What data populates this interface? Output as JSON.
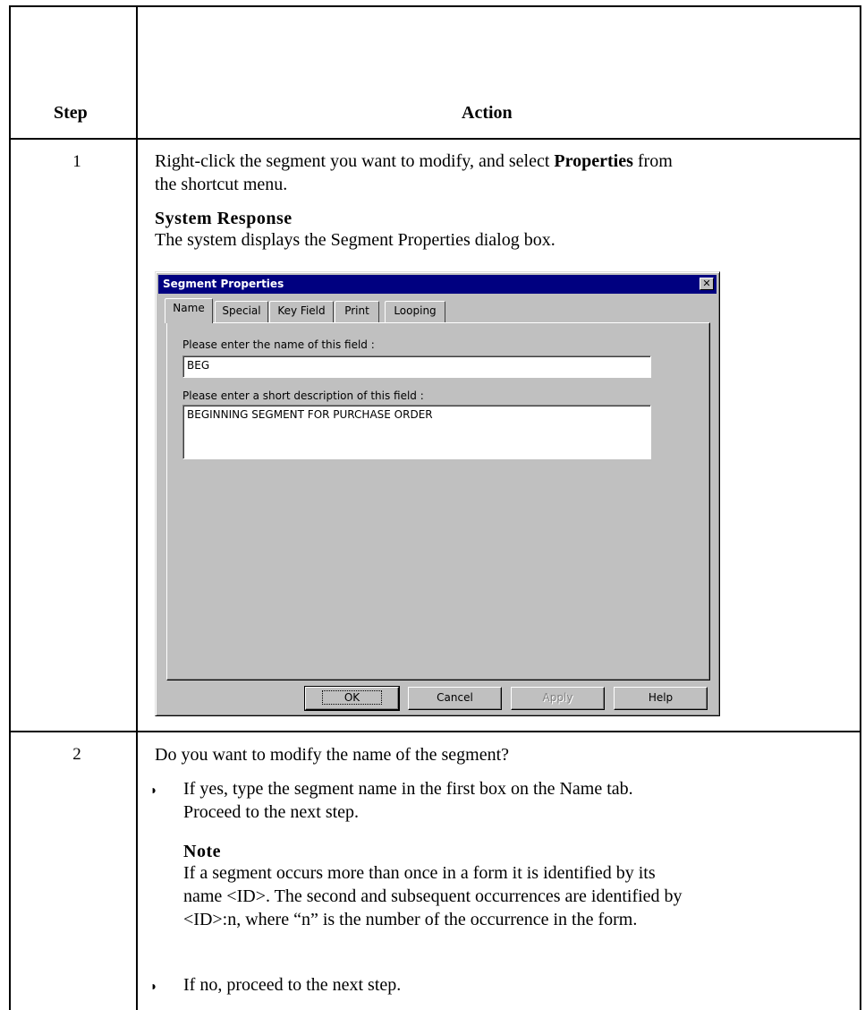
{
  "table": {
    "header_step": "Step",
    "header_action": "Action"
  },
  "step1": {
    "number": "1",
    "line1_pre": "Right-click the segment you want to modify, and select ",
    "line1_bold": "Properties",
    "line1_post": " from",
    "line2": "the shortcut menu.",
    "system_response_heading": "System Response",
    "system_response_text": "The system displays the Segment Properties dialog box."
  },
  "dialog": {
    "title": "Segment Properties",
    "close_glyph": "✕",
    "tabs": [
      "Name",
      "Special",
      "Key Field",
      "Print",
      "Looping"
    ],
    "name_label": "Please enter the name of this field :",
    "name_value": "BEG",
    "desc_label": "Please enter a short description of this field :",
    "desc_value": "BEGINNING SEGMENT FOR PURCHASE ORDER",
    "buttons": {
      "ok": "OK",
      "cancel": "Cancel",
      "apply": "Apply",
      "help": "Help"
    }
  },
  "step2": {
    "number": "2",
    "question": "Do you want to modify the name of the segment?",
    "bullet_glyph": "◗",
    "yes_line1": "If yes, type the segment name in the first box on the Name tab.",
    "yes_line2": "Proceed to the next step.",
    "note_heading": "Note",
    "note_line1": "If a segment occurs more than once in a form it is identified by its",
    "note_line2": "name <ID>. The second and subsequent occurrences are identified by",
    "note_line3": "<ID>:n, where “n” is the number of the occurrence in the form.",
    "no_text": "If no, proceed to the next step."
  }
}
